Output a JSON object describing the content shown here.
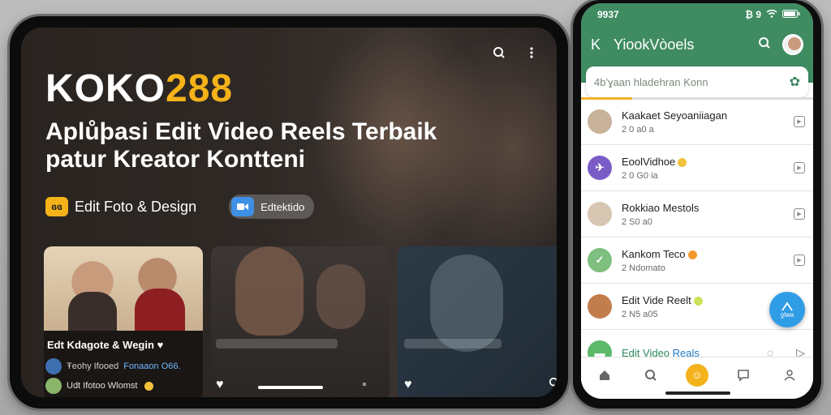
{
  "tablet": {
    "brand_main": "KOKO",
    "brand_accent": "288",
    "headline_line1": "Aplůþasi Edit Video Reels Terbaik",
    "headline_line2": "patur Kreator Kontteni",
    "chip1_badge": "ɞɞ",
    "chip1_label": "Edit Foto & Design",
    "chip2_label": "Edtektido",
    "card1": {
      "title": "Edt Kdagote & Wegin",
      "row1_text_a": "Ŧeohy Ifooed",
      "row1_text_b": "Fonaaon O66.",
      "row2_text": "Udt Ifotoo Wlomst"
    }
  },
  "phone": {
    "status_time": "9937",
    "status_signal": "₿ 9",
    "appbar_back": "K",
    "appbar_title": "YiookVòoels",
    "search_placeholder": "4b'ɣaan hladehran Konn",
    "list": [
      {
        "name": "Kaakaet Seyoaniiagan",
        "sub": "2 0 a0 a",
        "avatar_color": "#c8b39a"
      },
      {
        "name": "EoolVidhoe",
        "sub": "2 0 G0 ia",
        "avatar_color": "#7b5cc6",
        "emoji": true
      },
      {
        "name": "Rokkiao Mestols",
        "sub": "2 S0 a0",
        "avatar_color": "#d7c6b2"
      },
      {
        "name": "Kankom Teco",
        "sub": "2 Ndomato",
        "avatar_color": "#7fbf7f",
        "emoji": true
      },
      {
        "name": "Edit Vide Reelt",
        "sub": "2 N5 a05",
        "avatar_color": "#c27d4c",
        "emoji": true
      }
    ],
    "last_item": {
      "name_part_a": "Edit Video ",
      "name_part_b": "Reals"
    },
    "fab_label": "ƍlwa"
  },
  "colors": {
    "brand_accent": "#f5b319",
    "phone_header": "#3f8b62",
    "fab": "#2f9ce6",
    "nav_center": "#f4b31c"
  },
  "icons": [
    "search-icon",
    "more-vertical-icon",
    "heart-icon",
    "share-icon",
    "home-icon",
    "chat-icon",
    "profile-icon",
    "leaf-icon"
  ]
}
